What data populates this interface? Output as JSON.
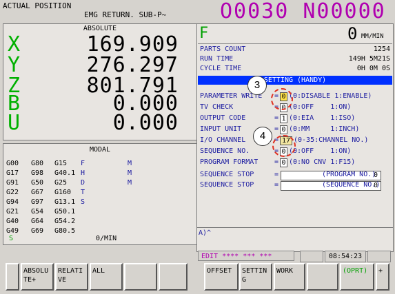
{
  "header": {
    "mode": "ACTUAL POSITION",
    "sub": "EMG RETURN. SUB-P~",
    "program_number": "O0030 N00000"
  },
  "absolute": {
    "title": "ABSOLUTE",
    "axes": [
      {
        "name": "X",
        "value": "169.909"
      },
      {
        "name": "Y",
        "value": "276.297"
      },
      {
        "name": "Z",
        "value": "801.791"
      },
      {
        "name": "B",
        "value": "0.000"
      },
      {
        "name": "U",
        "value": "0.000"
      }
    ]
  },
  "modal": {
    "title": "MODAL",
    "rows": [
      [
        "G00",
        "G80",
        "G15",
        "F",
        "M"
      ],
      [
        "G17",
        "G98",
        "G40.1",
        "H",
        "M"
      ],
      [
        "G91",
        "G50",
        "G25",
        "D",
        "M"
      ],
      [
        "G22",
        "G67",
        "G160",
        "T",
        ""
      ],
      [
        "G94",
        "G97",
        "G13.1",
        "S",
        ""
      ],
      [
        "G21",
        "G54",
        "G50.1",
        "",
        ""
      ],
      [
        "G40",
        "G64",
        "G54.2",
        "",
        ""
      ],
      [
        "G49",
        "G69",
        "G80.5",
        "",
        ""
      ]
    ],
    "s_label": "S",
    "rate": "0/MIN"
  },
  "right": {
    "f_label": "F",
    "feed_value": "0",
    "feed_unit": "MM/MIN",
    "parts_count_label": "PARTS COUNT",
    "parts_count": "1254",
    "run_time_label": "RUN TIME",
    "run_time": "149H 5M21S",
    "cycle_time_label": "CYCLE TIME",
    "cycle_time": "0H 0M 0S",
    "setting_title": "SETTING (HANDY)",
    "params": [
      {
        "label": "PARAMETER WRITE",
        "value": "0",
        "desc": "(0:DISABLE 1:ENABLE)"
      },
      {
        "label": "TV CHECK",
        "value": "0",
        "desc": "(0:OFF    1:ON)"
      },
      {
        "label": "OUTPUT CODE",
        "value": "1",
        "desc": "(0:EIA    1:ISO)"
      },
      {
        "label": "INPUT UNIT",
        "value": "0",
        "desc": "(0:MM     1:INCH)"
      },
      {
        "label": "I/O CHANNEL",
        "value": "17",
        "desc": "(0-35:CHANNEL NO.)"
      },
      {
        "label": "SEQUENCE NO.",
        "value": "0",
        "desc": "(0:OFF    1:ON)"
      },
      {
        "label": "PROGRAM FORMAT",
        "value": "0",
        "desc": "(0:NO CNV 1:F15)"
      }
    ],
    "seq_stop_1": {
      "label": "SEQUENCE STOP",
      "value": "0",
      "desc": "(PROGRAM NO.)"
    },
    "seq_stop_2": {
      "label": "SEQUENCE STOP",
      "value": "0",
      "desc": "(SEQUENCE NO.)"
    }
  },
  "input_line": {
    "prompt": "A)^"
  },
  "status": {
    "mode": "EDIT **** *** ***",
    "time": "08:54:23"
  },
  "annotations": {
    "a3": "3",
    "a4": "4"
  },
  "softkeys": {
    "k1": "",
    "k2": "ABSOLU\nTE+",
    "k3": "RELATI\nVE",
    "k4": "ALL",
    "k5": "",
    "k6": "",
    "k7": "OFFSET",
    "k8": "SETTIN\nG",
    "k9": "WORK",
    "k10": "",
    "k11": "(OPRT)",
    "k12": "+"
  },
  "colors": {
    "axis": "#00b000",
    "prog": "#b000b0",
    "title_bar": "#0030ff",
    "label": "#1a1aa0"
  }
}
